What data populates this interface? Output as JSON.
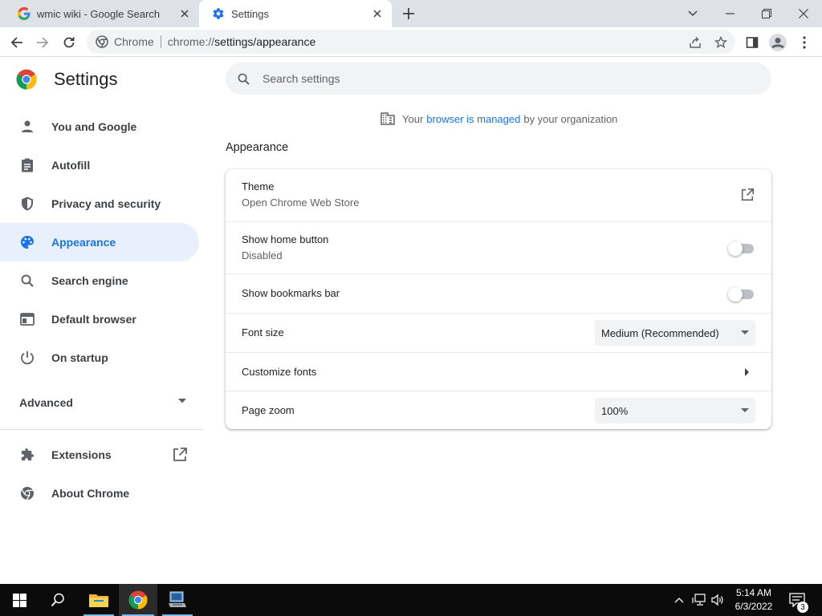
{
  "browser": {
    "tabs": [
      {
        "title": "wmic wiki - Google Search",
        "active": false
      },
      {
        "title": "Settings",
        "active": true
      }
    ],
    "omnibox": {
      "site_name": "Chrome",
      "url_scheme": "chrome://",
      "url_rest": "settings/appearance"
    }
  },
  "sidebar": {
    "title": "Settings",
    "items": [
      {
        "label": "You and Google",
        "icon": "person-icon"
      },
      {
        "label": "Autofill",
        "icon": "clipboard-icon"
      },
      {
        "label": "Privacy and security",
        "icon": "shield-icon"
      },
      {
        "label": "Appearance",
        "icon": "palette-icon",
        "active": true
      },
      {
        "label": "Search engine",
        "icon": "search-icon"
      },
      {
        "label": "Default browser",
        "icon": "browser-window-icon"
      },
      {
        "label": "On startup",
        "icon": "power-icon"
      }
    ],
    "advanced_label": "Advanced",
    "extensions_label": "Extensions",
    "about_label": "About Chrome"
  },
  "main": {
    "search_placeholder": "Search settings",
    "managed": {
      "prefix": "Your",
      "link": "browser is managed",
      "suffix": "by your organization"
    },
    "section_title": "Appearance",
    "rows": {
      "theme": {
        "label": "Theme",
        "sub": "Open Chrome Web Store"
      },
      "home_button": {
        "label": "Show home button",
        "sub": "Disabled",
        "enabled": false
      },
      "bookmarks_bar": {
        "label": "Show bookmarks bar",
        "enabled": false
      },
      "font_size": {
        "label": "Font size",
        "value": "Medium (Recommended)"
      },
      "customize_fonts": {
        "label": "Customize fonts"
      },
      "page_zoom": {
        "label": "Page zoom",
        "value": "100%"
      }
    }
  },
  "taskbar": {
    "time": "5:14 AM",
    "date": "6/3/2022",
    "notification_count": "3"
  },
  "colors": {
    "accent": "#1a73e8",
    "active_nav_bg": "#e8f0fe",
    "tabstrip_bg": "#dee1e6",
    "taskbar_bg": "#0b0b0b"
  }
}
